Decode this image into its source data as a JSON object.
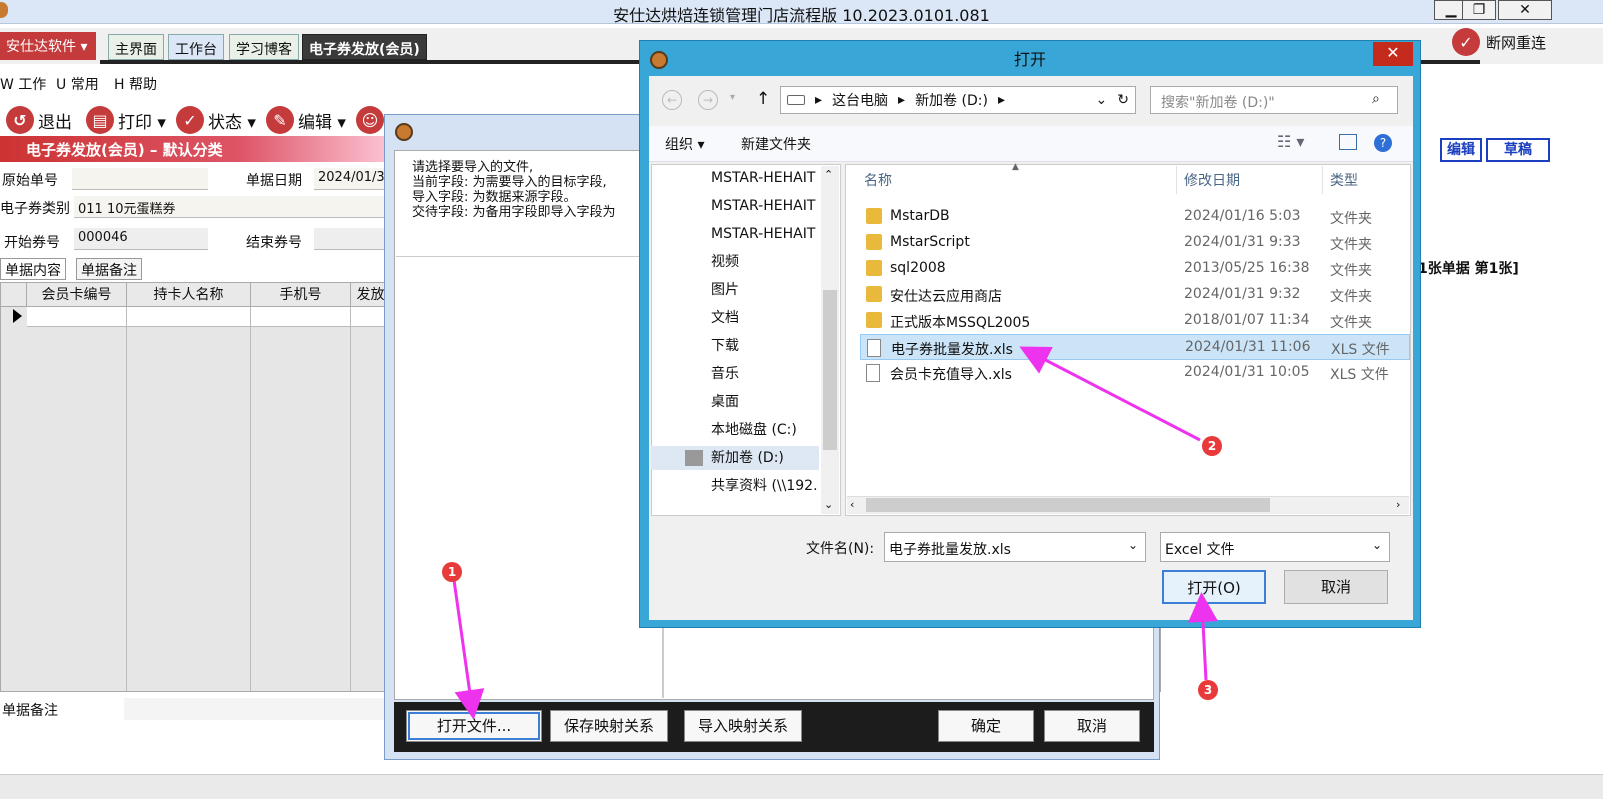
{
  "window": {
    "title": "安仕达烘焙连锁管理门店流程版   10.2023.0101.081",
    "controls": [
      "▁",
      "❐",
      "✕"
    ]
  },
  "brand_button": "安仕达软件 ▾",
  "tabs": [
    "主界面",
    "工作台",
    "学习博客",
    "电子券发放(会员)"
  ],
  "reconnect": "断网重连",
  "menu": [
    "W 工作",
    "U 常用",
    "H 帮助"
  ],
  "toolbar": {
    "exit": "退出",
    "print": "打印 ▾",
    "status": "状态 ▾",
    "edit": "编辑 ▾"
  },
  "doc_header": "电子券发放(会员) – 默认分类",
  "form": {
    "orig_no_label": "原始单号",
    "orig_no_value": "",
    "date_label": "单据日期",
    "date_value": "2024/01/3",
    "type_label": "电子券类别",
    "type_value": "011  10元蛋糕券",
    "start_label": "开始券号",
    "start_value": "000046",
    "end_label": "结束券号",
    "end_value": ""
  },
  "subtabs": [
    "单据内容",
    "单据备注"
  ],
  "grid_headers": [
    "会员卡编号",
    "持卡人名称",
    "手机号",
    "发放"
  ],
  "memo_label": "单据备注",
  "side_buttons": [
    "编辑",
    "草稿"
  ],
  "bill_count": "1张单据   第1张]",
  "import_dialog": {
    "text_lines": [
      "请选择要导入的文件,",
      "当前字段: 为需要导入的目标字段,",
      "导入字段: 为数据来源字段。",
      "交待字段: 为备用字段即导入字段为"
    ],
    "buttons": [
      "打开文件...",
      "保存映射关系",
      "导入映射关系",
      "确定",
      "取消"
    ]
  },
  "open_dialog": {
    "title": "打开",
    "close": "✕",
    "breadcrumb": [
      "这台电脑",
      "新加卷 (D:)"
    ],
    "search_placeholder": "搜索\"新加卷 (D:)\"",
    "organize": "组织 ▾",
    "new_folder": "新建文件夹",
    "nav_items": [
      {
        "label": "MSTAR-HEHAIT",
        "icon": "network-computer-icon"
      },
      {
        "label": "MSTAR-HEHAIT",
        "icon": "network-computer-icon"
      },
      {
        "label": "MSTAR-HEHAIT",
        "icon": "network-computer-icon"
      },
      {
        "label": "视频",
        "icon": "video-library-icon"
      },
      {
        "label": "图片",
        "icon": "picture-library-icon"
      },
      {
        "label": "文档",
        "icon": "document-library-icon"
      },
      {
        "label": "下载",
        "icon": "download-folder-icon"
      },
      {
        "label": "音乐",
        "icon": "music-library-icon"
      },
      {
        "label": "桌面",
        "icon": "desktop-folder-icon"
      },
      {
        "label": "本地磁盘 (C:)",
        "icon": "local-disk-icon"
      },
      {
        "label": "新加卷 (D:)",
        "icon": "drive-icon"
      },
      {
        "label": "共享资料 (\\\\192.",
        "icon": "network-drive-icon"
      }
    ],
    "columns": [
      "名称",
      "修改日期",
      "类型"
    ],
    "files": [
      {
        "name": "MstarDB",
        "date": "2024/01/16 5:03",
        "type": "文件夹",
        "kind": "folder"
      },
      {
        "name": "MstarScript",
        "date": "2024/01/31 9:33",
        "type": "文件夹",
        "kind": "folder"
      },
      {
        "name": "sql2008",
        "date": "2013/05/25 16:38",
        "type": "文件夹",
        "kind": "folder"
      },
      {
        "name": "安仕达云应用商店",
        "date": "2024/01/31 9:32",
        "type": "文件夹",
        "kind": "folder"
      },
      {
        "name": "正式版本MSSQL2005",
        "date": "2018/01/07 11:34",
        "type": "文件夹",
        "kind": "folder"
      },
      {
        "name": "电子券批量发放.xls",
        "date": "2024/01/31 11:06",
        "type": "XLS 文件",
        "kind": "file"
      },
      {
        "name": "会员卡充值导入.xls",
        "date": "2024/01/31 10:05",
        "type": "XLS 文件",
        "kind": "file"
      }
    ],
    "selected_index": 5,
    "filename_label": "文件名(N):",
    "filename_value": "电子券批量发放.xls",
    "filetype_value": "Excel 文件",
    "open_button": "打开(O)",
    "cancel_button": "取消"
  },
  "markers": [
    "1",
    "2",
    "3"
  ],
  "colors": {
    "annotation_arrow": "#ee33ee",
    "marker": "#e83a3a",
    "dialog_frame": "#38a7d8",
    "brand": "#c53a3a"
  }
}
